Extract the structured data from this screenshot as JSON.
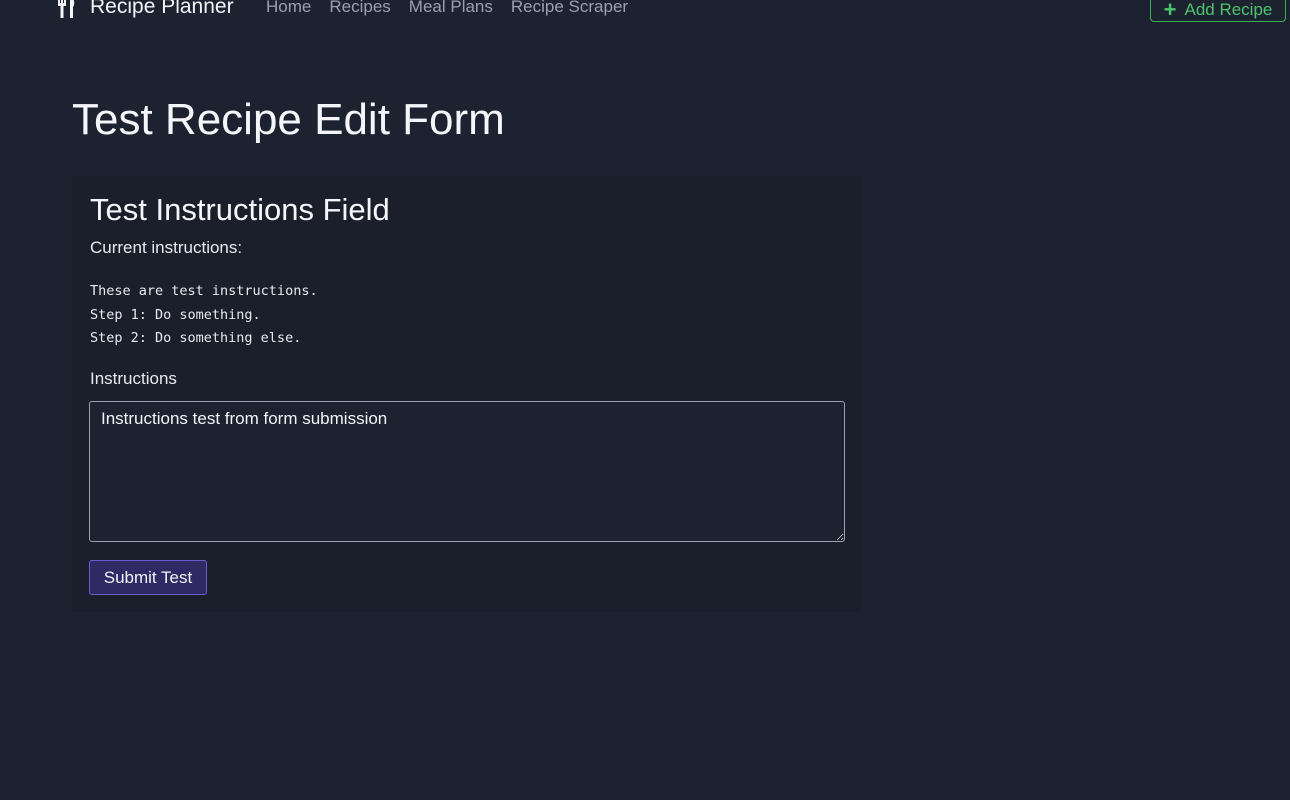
{
  "navbar": {
    "brand": "Recipe Planner",
    "brand_icon": "fork-knife-icon",
    "links": [
      "Home",
      "Recipes",
      "Meal Plans",
      "Recipe Scraper"
    ],
    "add_button": {
      "icon": "plus-icon",
      "label": "Add Recipe"
    }
  },
  "page": {
    "title": "Test Recipe Edit Form"
  },
  "card": {
    "title": "Test Instructions Field",
    "current_label": "Current instructions:",
    "current_instructions": "These are test instructions.\nStep 1: Do something.\nStep 2: Do something else.",
    "field_label": "Instructions",
    "textarea_value": "Instructions test from form submission",
    "submit_label": "Submit Test"
  },
  "colors": {
    "background": "#1d2230",
    "accent_green": "#4cc46a",
    "button_purple": "#2f2a63"
  }
}
